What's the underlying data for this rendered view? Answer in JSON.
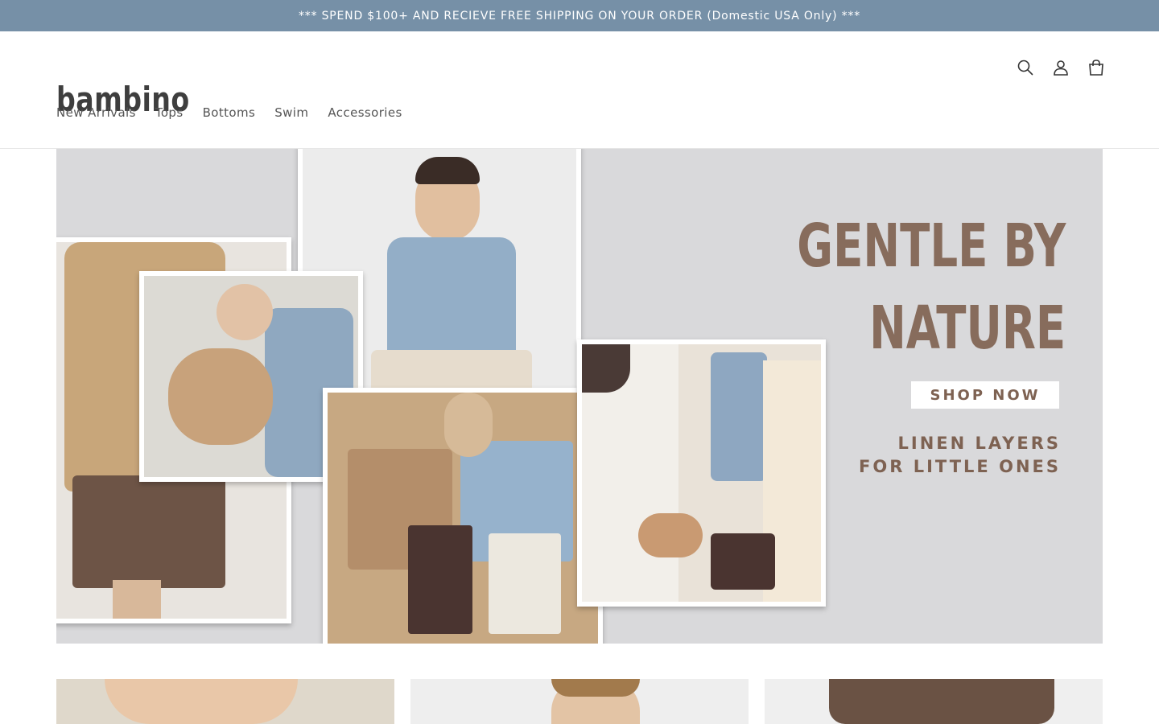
{
  "announcement": "*** SPEND $100+ AND RECIEVE FREE SHIPPING ON YOUR ORDER (Domestic USA Only) ***",
  "brand": {
    "logo": "bambino"
  },
  "header_icons": [
    "search-icon",
    "account-icon",
    "cart-icon"
  ],
  "nav": {
    "items": [
      "New Arrivals",
      "Tops",
      "Bottoms",
      "Swim",
      "Accessories"
    ]
  },
  "hero": {
    "title": "GENTLE BY\nNATURE",
    "button": "SHOP NOW",
    "tagline": "LINEN LAYERS\nFOR LITTLE ONES"
  },
  "colors": {
    "announcement_bar": "#7690a7",
    "hero_background": "#d9d9db",
    "hero_text": "#876c5c"
  }
}
